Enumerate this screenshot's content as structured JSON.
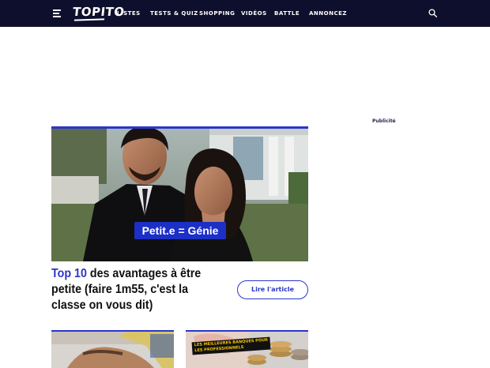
{
  "header": {
    "logo": "TOPITO",
    "nav": [
      {
        "label": "LISTES"
      },
      {
        "label": "TESTS & QUIZ"
      },
      {
        "label": "SHOPPING"
      },
      {
        "label": "VIDÉOS"
      },
      {
        "label": "BATTLE"
      },
      {
        "label": "ANNONCEZ"
      }
    ]
  },
  "ad": {
    "label": "Publicité"
  },
  "hero": {
    "caption": "Petit.e = Génie",
    "title_accent": "Top 10",
    "title_rest": " des avantages à être petite (faire 1m55, c'est la classe on vous dit)",
    "button": "Lire l'article"
  },
  "thumbs": [
    {
      "badge": ""
    },
    {
      "badge_line1": "LES MEILLEURES BANQUES POUR",
      "badge_line2": "LES PROFESSIONNELS"
    }
  ],
  "colors": {
    "topbar": "#0e0f2c",
    "accent": "#2b36c9",
    "caption_bg": "#1c2fc7"
  }
}
